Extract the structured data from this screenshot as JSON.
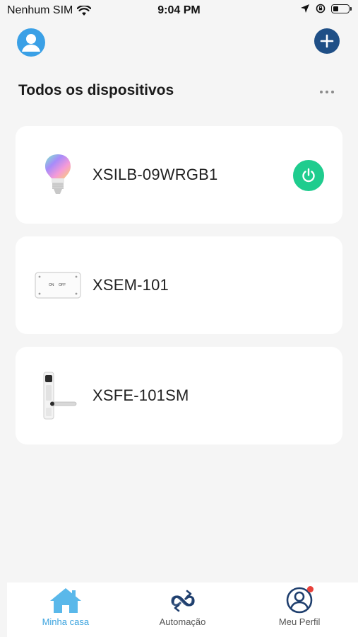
{
  "status_bar": {
    "carrier": "Nenhum SIM",
    "time": "9:04 PM"
  },
  "header": {
    "avatar_icon": "user-avatar-icon",
    "add_icon": "plus-icon"
  },
  "section": {
    "title": "Todos os dispositivos",
    "more_icon": "more-horizontal-icon"
  },
  "devices": [
    {
      "name": "XSILB-09WRGB1",
      "icon": "smart-bulb-icon",
      "power_button": true
    },
    {
      "name": "XSEM-101",
      "icon": "switch-module-icon",
      "thumb_text_on": "ON",
      "thumb_text_off": "OFF"
    },
    {
      "name": "XSFE-101SM",
      "icon": "smart-lock-icon"
    }
  ],
  "tabs": [
    {
      "label": "Minha casa",
      "icon": "home-icon",
      "active": true
    },
    {
      "label": "Automação",
      "icon": "automation-icon",
      "active": false
    },
    {
      "label": "Meu Perfil",
      "icon": "profile-icon",
      "active": false,
      "badge": true
    }
  ],
  "colors": {
    "accent": "#3ba3df",
    "power_green": "#1fcc8e",
    "add_button": "#1f4f86",
    "badge_red": "#e8413a"
  }
}
